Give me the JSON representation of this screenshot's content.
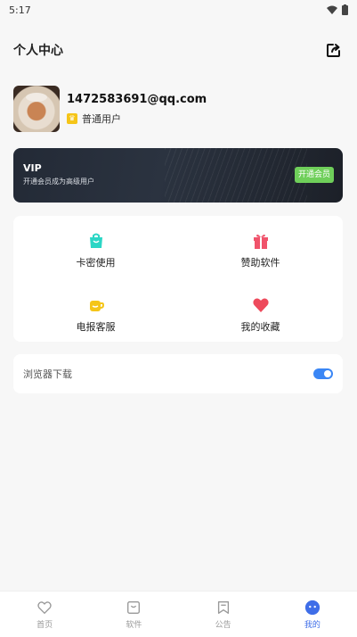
{
  "status": {
    "time": "5:17"
  },
  "header": {
    "title": "个人中心"
  },
  "profile": {
    "email": "1472583691@qq.com",
    "level": "普通用户"
  },
  "vip": {
    "title": "VIP",
    "desc": "开通会员成为高级用户",
    "button": "开通会员"
  },
  "grid": {
    "items": [
      {
        "label": "卡密使用",
        "icon": "shopping-bag-icon",
        "color": "#2bd6c5"
      },
      {
        "label": "赞助软件",
        "icon": "gift-icon",
        "color": "#f0536b"
      },
      {
        "label": "电报客服",
        "icon": "cup-icon",
        "color": "#f5c518"
      },
      {
        "label": "我的收藏",
        "icon": "heart-icon",
        "color": "#ee4a5c"
      }
    ]
  },
  "settings": {
    "browser_download_label": "浏览器下载",
    "browser_download_on": true
  },
  "tabbar": {
    "items": [
      {
        "label": "首页",
        "icon": "heart-outline-icon"
      },
      {
        "label": "软件",
        "icon": "bag-outline-icon"
      },
      {
        "label": "公告",
        "icon": "bookmark-outline-icon"
      },
      {
        "label": "我的",
        "icon": "smiley-icon",
        "active": true
      }
    ]
  },
  "colors": {
    "accent": "#3f6ee8",
    "toggle": "#3a86f5",
    "vip_button": "#6fcf5a"
  }
}
